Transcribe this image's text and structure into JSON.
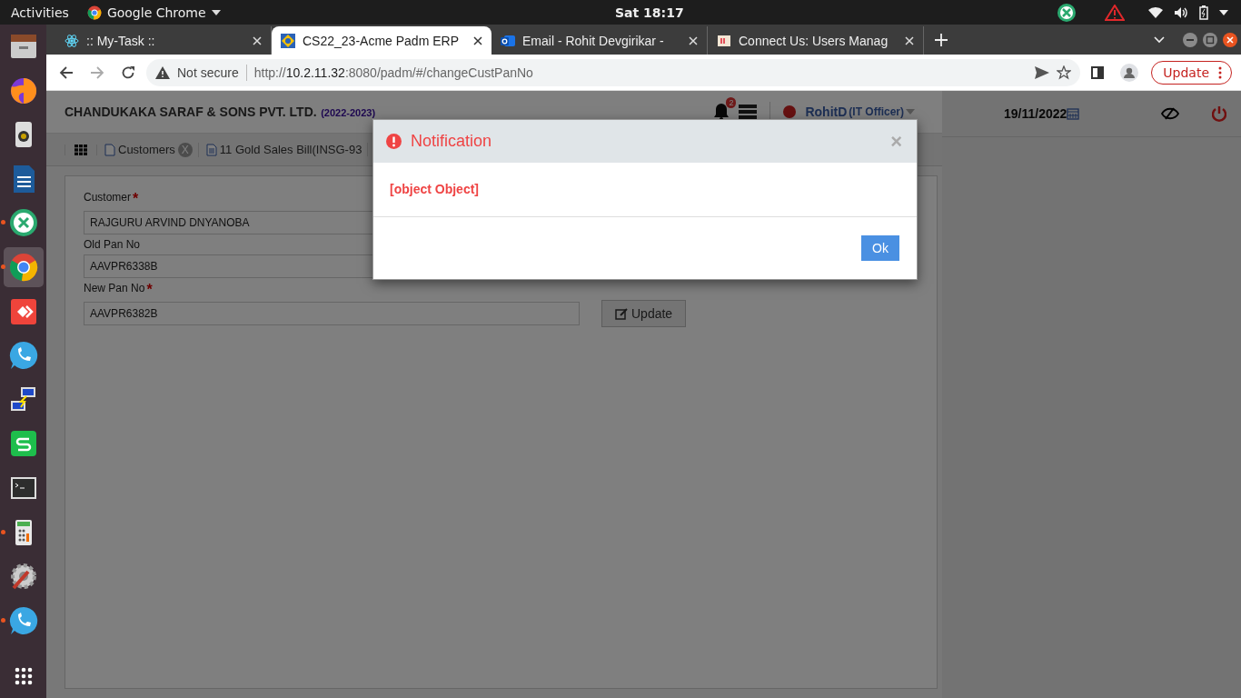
{
  "top_bar": {
    "activities": "Activities",
    "app_menu": "Google Chrome",
    "clock": "Sat 18:17"
  },
  "dock": [
    {
      "running": false,
      "selected": false
    },
    {
      "running": false,
      "selected": false
    },
    {
      "running": false,
      "selected": false
    },
    {
      "running": false,
      "selected": false
    },
    {
      "running": true,
      "selected": false
    },
    {
      "running": true,
      "selected": true
    },
    {
      "running": false,
      "selected": false
    },
    {
      "running": false,
      "selected": false
    },
    {
      "running": false,
      "selected": false
    },
    {
      "running": false,
      "selected": false
    },
    {
      "running": false,
      "selected": false
    },
    {
      "running": true,
      "selected": false
    },
    {
      "running": false,
      "selected": false
    },
    {
      "running": true,
      "selected": false
    }
  ],
  "browser": {
    "tabs": [
      {
        "title": ":: My-Task ::",
        "selected": false
      },
      {
        "title": "CS22_23-Acme Padm ERP",
        "selected": true
      },
      {
        "title": "Email - Rohit Devgirikar -",
        "selected": false
      },
      {
        "title": "Connect Us: Users Manag",
        "selected": false
      }
    ],
    "security": "Not secure",
    "url": "http://**10.2.11.32**:8080/padm/#/changeCustPanNo",
    "update_button": "Update"
  },
  "header": {
    "company": "CHANDUKAKA SARAF & SONS PVT. LTD.",
    "year": "(2022-2023)",
    "notification_count": "2",
    "user": "RohitD",
    "role": "(IT Officer)",
    "date": "19/11/2022"
  },
  "page_tabs": [
    {
      "title": "Customers",
      "close": "X"
    },
    {
      "title": "11 Gold Sales Bill(INSG-93"
    }
  ],
  "form": {
    "fields": [
      {
        "label": "Customer",
        "required_mark": "*",
        "value": "RAJGURU ARVIND DNYANOBA"
      },
      {
        "label": "Old Pan No",
        "value": "AAVPR6338B"
      },
      {
        "label": "New Pan No",
        "required_mark": "*",
        "value": "AAVPR6382B"
      }
    ],
    "update_button": "Update"
  },
  "dialog": {
    "title": "Notification",
    "close": "×",
    "message": "[object Object]",
    "ok_button": "Ok"
  }
}
